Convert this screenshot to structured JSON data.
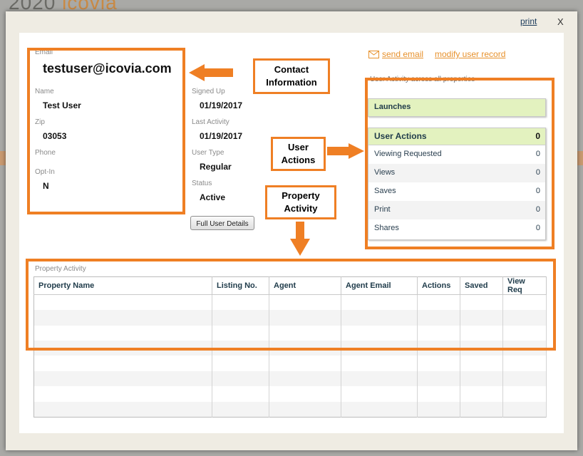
{
  "background": {
    "logo_text": "2020",
    "logo_accent": "icovia"
  },
  "modal": {
    "print_label": "print",
    "close_label": "X"
  },
  "contact": {
    "email_label": "Email",
    "email_value": "testuser@icovia.com",
    "name_label": "Name",
    "name_value": "Test User",
    "zip_label": "Zip",
    "zip_value": "03053",
    "phone_label": "Phone",
    "phone_value": "",
    "optin_label": "Opt-In",
    "optin_value": "N"
  },
  "account": {
    "signed_up_label": "Signed Up",
    "signed_up_value": "01/19/2017",
    "last_activity_label": "Last Activity",
    "last_activity_value": "01/19/2017",
    "user_type_label": "User Type",
    "user_type_value": "Regular",
    "status_label": "Status",
    "status_value": "Active",
    "full_details_button": "Full User Details"
  },
  "links": {
    "send_email": "send email",
    "modify_user": "modify user record"
  },
  "activity_panel": {
    "title": "User Activity across all properties",
    "launches_label": "Launches",
    "user_actions_label": "User Actions",
    "user_actions_total": "0",
    "rows": [
      {
        "label": "Viewing Requested",
        "value": "0"
      },
      {
        "label": "Views",
        "value": "0"
      },
      {
        "label": "Saves",
        "value": "0"
      },
      {
        "label": "Print",
        "value": "0"
      },
      {
        "label": "Shares",
        "value": "0"
      }
    ]
  },
  "property_activity": {
    "title": "Property Activity",
    "columns": [
      "Property Name",
      "Listing No.",
      "Agent",
      "Agent Email",
      "Actions",
      "Saved",
      "View Req"
    ]
  },
  "annotations": {
    "contact_callout": "Contact Information",
    "user_actions_callout": "User Actions",
    "property_callout": "Property Activity"
  },
  "colors": {
    "highlight": "#ef7f24",
    "accent_green": "#e3f2bf",
    "link": "#e7912c"
  },
  "icons": {
    "mail": "mail-icon",
    "arrow": "arrow-icon"
  }
}
